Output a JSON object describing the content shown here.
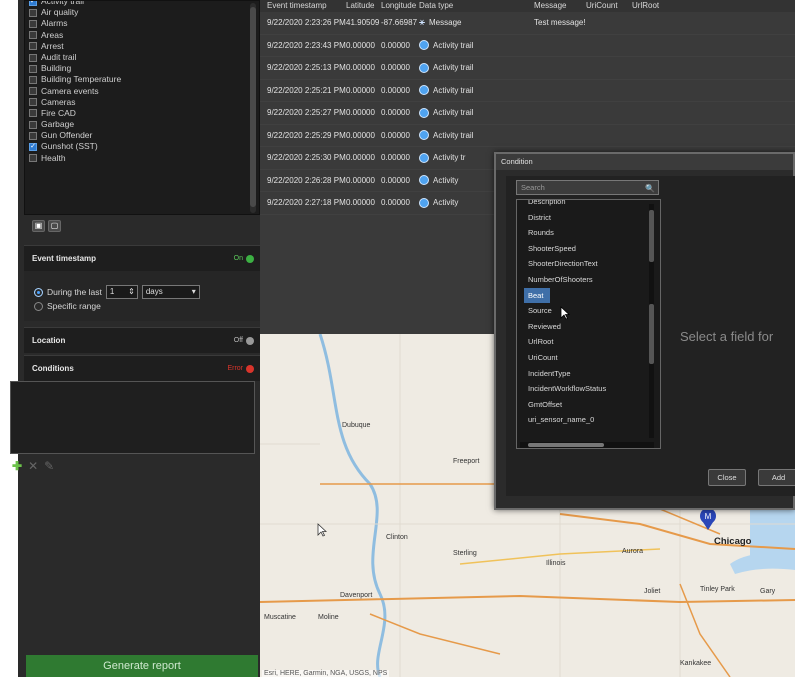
{
  "sidebar": {
    "event_types": [
      {
        "label": "Activity trail",
        "checked": true
      },
      {
        "label": "Air quality",
        "checked": false
      },
      {
        "label": "Alarms",
        "checked": false
      },
      {
        "label": "Areas",
        "checked": false
      },
      {
        "label": "Arrest",
        "checked": false
      },
      {
        "label": "Audit trail",
        "checked": false
      },
      {
        "label": "Building",
        "checked": false
      },
      {
        "label": "Building Temperature",
        "checked": false
      },
      {
        "label": "Camera events",
        "checked": false
      },
      {
        "label": "Cameras",
        "checked": false
      },
      {
        "label": "Fire CAD",
        "checked": false
      },
      {
        "label": "Garbage",
        "checked": false
      },
      {
        "label": "Gun Offender",
        "checked": false
      },
      {
        "label": "Gunshot (SST)",
        "checked": true
      },
      {
        "label": "Health",
        "checked": false
      }
    ],
    "event_timestamp": {
      "title": "Event timestamp",
      "toggle": "On",
      "during_label": "During the last",
      "amount": "1",
      "unit": "days",
      "specific_label": "Specific range"
    },
    "location": {
      "title": "Location",
      "toggle": "Off"
    },
    "conditions": {
      "title": "Conditions",
      "toggle": "Error"
    },
    "generate_label": "Generate report"
  },
  "results": {
    "columns": [
      "Event timestamp",
      "Latitude",
      "Longitude",
      "Data type",
      "Message",
      "UriCount",
      "UrlRoot"
    ],
    "rows": [
      {
        "timestamp": "9/22/2020 2:23:26 PM",
        "lat": "41.90509",
        "lon": "-87.66987",
        "type": "Message",
        "message": "Test message!"
      },
      {
        "timestamp": "9/22/2020 2:23:43 PM",
        "lat": "0.00000",
        "lon": "0.00000",
        "type": "Activity trail",
        "message": ""
      },
      {
        "timestamp": "9/22/2020 2:25:13 PM",
        "lat": "0.00000",
        "lon": "0.00000",
        "type": "Activity trail",
        "message": ""
      },
      {
        "timestamp": "9/22/2020 2:25:21 PM",
        "lat": "0.00000",
        "lon": "0.00000",
        "type": "Activity trail",
        "message": ""
      },
      {
        "timestamp": "9/22/2020 2:25:27 PM",
        "lat": "0.00000",
        "lon": "0.00000",
        "type": "Activity trail",
        "message": ""
      },
      {
        "timestamp": "9/22/2020 2:25:29 PM",
        "lat": "0.00000",
        "lon": "0.00000",
        "type": "Activity trail",
        "message": ""
      },
      {
        "timestamp": "9/22/2020 2:25:30 PM",
        "lat": "0.00000",
        "lon": "0.00000",
        "type": "Activity tr",
        "message": ""
      },
      {
        "timestamp": "9/22/2020 2:26:28 PM",
        "lat": "0.00000",
        "lon": "0.00000",
        "type": "Activity",
        "message": ""
      },
      {
        "timestamp": "9/22/2020 2:27:18 PM",
        "lat": "0.00000",
        "lon": "0.00000",
        "type": "Activity",
        "message": ""
      }
    ]
  },
  "map": {
    "places": [
      "Dubuque",
      "Freeport",
      "Clinton",
      "Sterling",
      "Illinois",
      "Aurora",
      "Chicago",
      "Joliet",
      "Tinley Park",
      "Gary",
      "Davenport",
      "Moline",
      "Muscatine",
      "Kankakee"
    ],
    "marker_letter": "M",
    "attribution": "Esri, HERE, Garmin, NGA, USGS, NPS"
  },
  "dialog": {
    "title": "Condition",
    "search_placeholder": "Search",
    "fields": [
      "Description",
      "District",
      "Rounds",
      "ShooterSpeed",
      "ShooterDirectionText",
      "NumberOfShooters",
      "Beat",
      "Source",
      "Reviewed",
      "UrlRoot",
      "UriCount",
      "IncidentType",
      "IncidentWorkflowStatus",
      "GmtOffset",
      "uri_sensor_name_0"
    ],
    "selected_field": "Beat",
    "placeholder": "Select a field for",
    "close_label": "Close",
    "add_label": "Add"
  },
  "colors": {
    "accent": "#2e7bd1",
    "generate": "#2f7a31",
    "on": "#3cb043",
    "error": "#d9342b"
  }
}
